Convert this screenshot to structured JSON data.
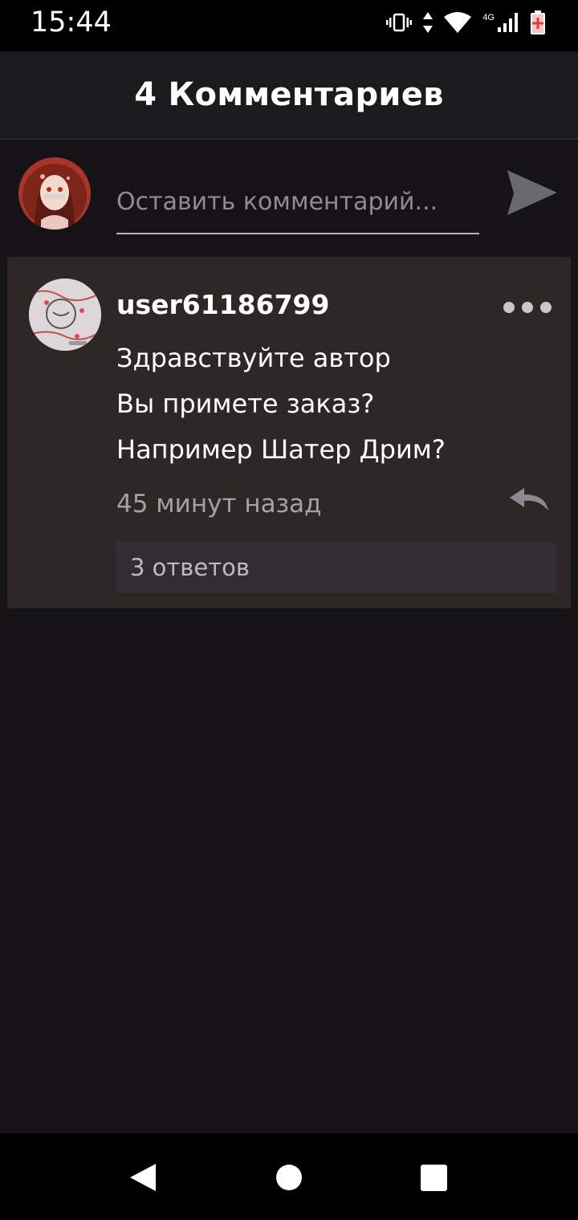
{
  "status_bar": {
    "time": "15:44",
    "network_label": "4G",
    "icons": [
      "vibrate-icon",
      "data-arrows-icon",
      "wifi-icon",
      "signal-icon",
      "battery-icon"
    ]
  },
  "header": {
    "title": "4 Комментариев"
  },
  "composer": {
    "placeholder": "Оставить комментарий...",
    "send_icon": "send-icon"
  },
  "comments": [
    {
      "username": "user61186799",
      "lines": [
        "Здравствуйте автор",
        "Вы примете заказ?",
        "Например Шатер Дрим?"
      ],
      "time": "45 минут назад",
      "replies_label": "3 ответов"
    }
  ],
  "colors": {
    "background": "#151316",
    "header": "#1b1a1c",
    "comment_card": "#2d2826",
    "replies_button": "#302e33",
    "muted_text": "#a3a0a7"
  },
  "nav_bar": {
    "icons": [
      "back-icon",
      "home-icon",
      "recents-icon"
    ]
  }
}
